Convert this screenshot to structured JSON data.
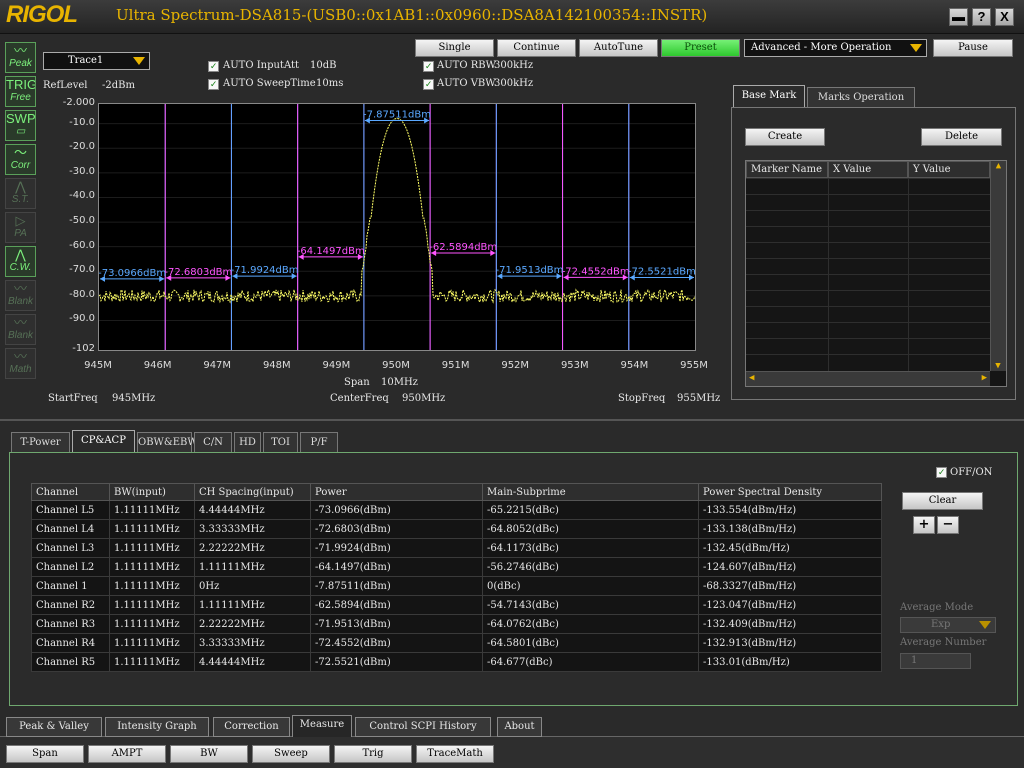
{
  "window": {
    "logo": "RIGOL",
    "title": "Ultra Spectrum-DSA815-(USB0::0x1AB1::0x0960::DSA8A142100354::INSTR)",
    "buttons": [
      "▬",
      "?",
      "X"
    ]
  },
  "toolbar": {
    "single": "Single",
    "continue": "Continue",
    "autotune": "AutoTune",
    "preset": "Preset",
    "mode_select": "Advanced - More Operation",
    "pause": "Pause"
  },
  "side_icons": [
    {
      "icon": "〰",
      "label": "Peak",
      "state": "on"
    },
    {
      "icon": "TRIG",
      "label": "Free",
      "state": "on"
    },
    {
      "icon": "SWP",
      "label": "▭",
      "state": "on"
    },
    {
      "icon": "〜",
      "label": "Corr",
      "state": "on"
    },
    {
      "icon": "⋀",
      "label": "S.T.",
      "state": "off"
    },
    {
      "icon": "▷",
      "label": "PA",
      "state": "off"
    },
    {
      "icon": "⋀",
      "label": "C.W.",
      "state": "on"
    },
    {
      "icon": "〰",
      "label": "Blank",
      "state": "off"
    },
    {
      "icon": "〰",
      "label": "Blank",
      "state": "off"
    },
    {
      "icon": "〰",
      "label": "Math",
      "state": "off"
    }
  ],
  "trace": {
    "selected": "Trace1"
  },
  "settings": {
    "reflevel_label": "RefLevel",
    "reflevel_value": "-2dBm",
    "auto_inputatt": {
      "label": "AUTO InputAtt",
      "value": "10dB",
      "checked": true
    },
    "auto_sweeptime": {
      "label": "AUTO SweepTime",
      "value": "10ms",
      "checked": true
    },
    "auto_rbw": {
      "label": "AUTO RBW",
      "value": "300kHz",
      "checked": true
    },
    "auto_vbw": {
      "label": "AUTO VBW",
      "value": "300kHz",
      "checked": true
    }
  },
  "chart_data": {
    "type": "line",
    "x_unit": "MHz",
    "xlim": [
      945,
      955
    ],
    "ylim": [
      -102,
      -2
    ],
    "y_ticks": [
      "-2.000",
      "-10.0",
      "-20.0",
      "-30.0",
      "-40.0",
      "-50.0",
      "-60.0",
      "-70.0",
      "-80.0",
      "-90.0",
      "-102"
    ],
    "y_tick_values": [
      -2,
      -10,
      -20,
      -30,
      -40,
      -50,
      -60,
      -70,
      -80,
      -90,
      -102
    ],
    "x_ticks": [
      "945M",
      "946M",
      "947M",
      "948M",
      "949M",
      "950M",
      "951M",
      "952M",
      "953M",
      "954M",
      "955M"
    ],
    "x_tick_values": [
      945,
      946,
      947,
      948,
      949,
      950,
      951,
      952,
      953,
      954,
      955
    ],
    "trace_color": "#ffff66",
    "noise_floor": -80,
    "peak": {
      "freq": 950,
      "level": -7.87511
    },
    "channels": [
      {
        "label": "-73.0966dBm",
        "start": 945.0,
        "end": 946.1111,
        "power": -73.0966,
        "color": "#5aa8ff"
      },
      {
        "label": "-72.6803dBm",
        "start": 946.1111,
        "end": 947.2222,
        "power": -72.6803,
        "color": "#ff55ff"
      },
      {
        "label": "-71.9924dBm",
        "start": 947.2222,
        "end": 948.3333,
        "power": -71.9924,
        "color": "#5aa8ff"
      },
      {
        "label": "-64.1497dBm",
        "start": 948.3333,
        "end": 949.4444,
        "power": -64.1497,
        "color": "#ff55ff"
      },
      {
        "label": "-7.87511dBm",
        "start": 949.4444,
        "end": 950.5556,
        "power": -7.87511,
        "color": "#5aa8ff"
      },
      {
        "label": "-62.5894dBm",
        "start": 950.5556,
        "end": 951.6667,
        "power": -62.5894,
        "color": "#ff55ff"
      },
      {
        "label": "-71.9513dBm",
        "start": 951.6667,
        "end": 952.7778,
        "power": -71.9513,
        "color": "#5aa8ff"
      },
      {
        "label": "-72.4552dBm",
        "start": 952.7778,
        "end": 953.8889,
        "power": -72.4552,
        "color": "#ff55ff"
      },
      {
        "label": "-72.5521dBm",
        "start": 953.8889,
        "end": 955.0,
        "power": -72.5521,
        "color": "#5aa8ff"
      }
    ]
  },
  "freq": {
    "span_label": "Span",
    "span_value": "10MHz",
    "start_label": "StartFreq",
    "start_value": "945MHz",
    "center_label": "CenterFreq",
    "center_value": "950MHz",
    "stop_label": "StopFreq",
    "stop_value": "955MHz"
  },
  "marker_panel": {
    "tabs": [
      "Base Mark",
      "Marks Operation"
    ],
    "create": "Create",
    "delete": "Delete",
    "columns": [
      "Marker Name",
      "X Value",
      "Y Value"
    ]
  },
  "measure_tabs": [
    "T-Power",
    "CP&ACP",
    "OBW&EBW",
    "C/N",
    "HD",
    "TOI",
    "P/F"
  ],
  "acp_table": {
    "columns": [
      "Channel",
      "BW(input)",
      "CH Spacing(input)",
      "Power",
      "Main-Subprime",
      "Power Spectral Density"
    ],
    "rows": [
      [
        "Channel L5",
        "1.11111MHz",
        "4.44444MHz",
        "-73.0966(dBm)",
        "-65.2215(dBc)",
        "-133.554(dBm/Hz)"
      ],
      [
        "Channel L4",
        "1.11111MHz",
        "3.33333MHz",
        "-72.6803(dBm)",
        "-64.8052(dBc)",
        "-133.138(dBm/Hz)"
      ],
      [
        "Channel L3",
        "1.11111MHz",
        "2.22222MHz",
        "-71.9924(dBm)",
        "-64.1173(dBc)",
        "-132.45(dBm/Hz)"
      ],
      [
        "Channel L2",
        "1.11111MHz",
        "1.11111MHz",
        "-64.1497(dBm)",
        "-56.2746(dBc)",
        "-124.607(dBm/Hz)"
      ],
      [
        "Channel 1",
        "1.11111MHz",
        "0Hz",
        "-7.87511(dBm)",
        "0(dBc)",
        "-68.3327(dBm/Hz)"
      ],
      [
        "Channel R2",
        "1.11111MHz",
        "1.11111MHz",
        "-62.5894(dBm)",
        "-54.7143(dBc)",
        "-123.047(dBm/Hz)"
      ],
      [
        "Channel R3",
        "1.11111MHz",
        "2.22222MHz",
        "-71.9513(dBm)",
        "-64.0762(dBc)",
        "-132.409(dBm/Hz)"
      ],
      [
        "Channel R4",
        "1.11111MHz",
        "3.33333MHz",
        "-72.4552(dBm)",
        "-64.5801(dBc)",
        "-132.913(dBm/Hz)"
      ],
      [
        "Channel R5",
        "1.11111MHz",
        "4.44444MHz",
        "-72.5521(dBm)",
        "-64.677(dBc)",
        "-133.01(dBm/Hz)"
      ]
    ]
  },
  "acp_controls": {
    "offon_label": "OFF/ON",
    "offon_checked": true,
    "clear": "Clear",
    "plus": "+",
    "minus": "−",
    "avg_mode_label": "Average Mode",
    "avg_mode_value": "Exp",
    "avg_number_label": "Average Number",
    "avg_number_value": "1"
  },
  "bottom_tabs": [
    "Peak & Valley",
    "Intensity Graph",
    "Correction",
    "Measure",
    "Control SCPI History",
    "About"
  ],
  "function_buttons": [
    "Span",
    "AMPT",
    "BW",
    "Sweep",
    "Trig",
    "TraceMath"
  ]
}
